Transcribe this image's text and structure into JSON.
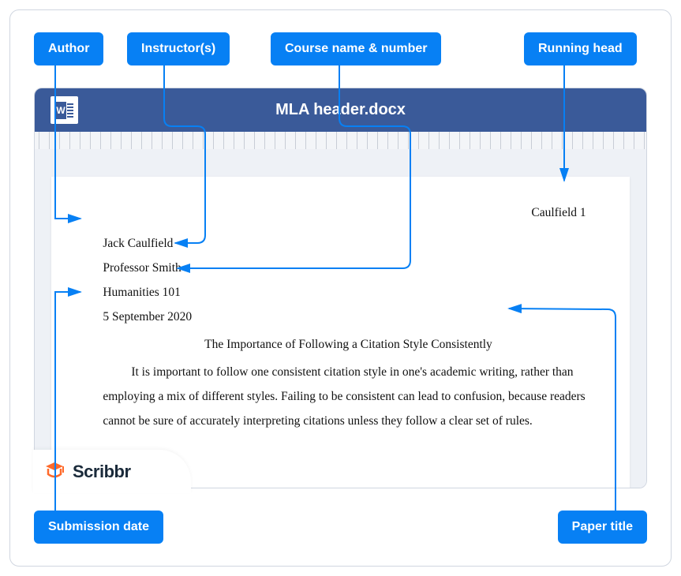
{
  "labels": {
    "author": "Author",
    "instructor": "Instructor(s)",
    "course": "Course name & number",
    "running_head": "Running head",
    "submission_date": "Submission date",
    "paper_title": "Paper title"
  },
  "document": {
    "filename": "MLA header.docx",
    "running_head": "Caulfield 1",
    "author": "Jack Caulfield",
    "instructor": "Professor Smith",
    "course": "Humanities 101",
    "date": "5 September 2020",
    "title": "The Importance of Following a Citation Style Consistently",
    "body": "It is important to follow one consistent citation style in one's academic writing, rather than employing a mix of different styles. Failing to be consistent can lead to confusion, because readers cannot be sure of accurately interpreting citations unless they follow a clear set of rules."
  },
  "brand": "Scribbr"
}
